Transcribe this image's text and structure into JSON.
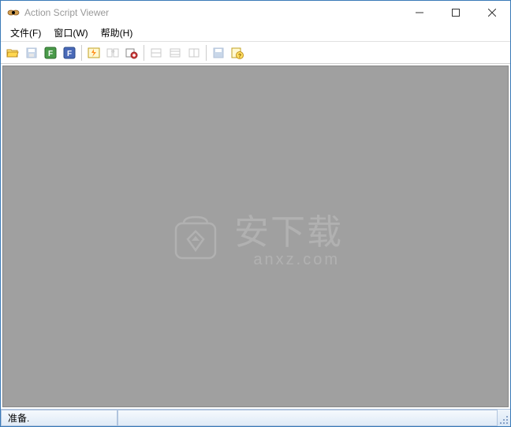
{
  "titlebar": {
    "title": "Action Script Viewer"
  },
  "menubar": {
    "items": [
      {
        "label": "文件(F)"
      },
      {
        "label": "窗口(W)"
      },
      {
        "label": "帮助(H)"
      }
    ]
  },
  "toolbar": {
    "buttons": [
      {
        "name": "open-folder-icon",
        "enabled": true
      },
      {
        "name": "save-icon",
        "enabled": false
      },
      {
        "name": "f-green-icon",
        "enabled": true
      },
      {
        "name": "f-blue-icon",
        "enabled": true
      },
      {
        "sep": true
      },
      {
        "name": "flash-icon",
        "enabled": true
      },
      {
        "name": "panel-swap-icon",
        "enabled": false
      },
      {
        "name": "export-red-icon",
        "enabled": true
      },
      {
        "sep": true
      },
      {
        "name": "layout-a-icon",
        "enabled": false
      },
      {
        "name": "layout-b-icon",
        "enabled": false
      },
      {
        "name": "layout-c-icon",
        "enabled": false
      },
      {
        "sep": true
      },
      {
        "name": "save-disk-icon",
        "enabled": false
      },
      {
        "name": "help-icon",
        "enabled": true
      }
    ]
  },
  "watermark": {
    "text": "安下载",
    "sub": "anxz.com"
  },
  "statusbar": {
    "ready": "准备."
  }
}
